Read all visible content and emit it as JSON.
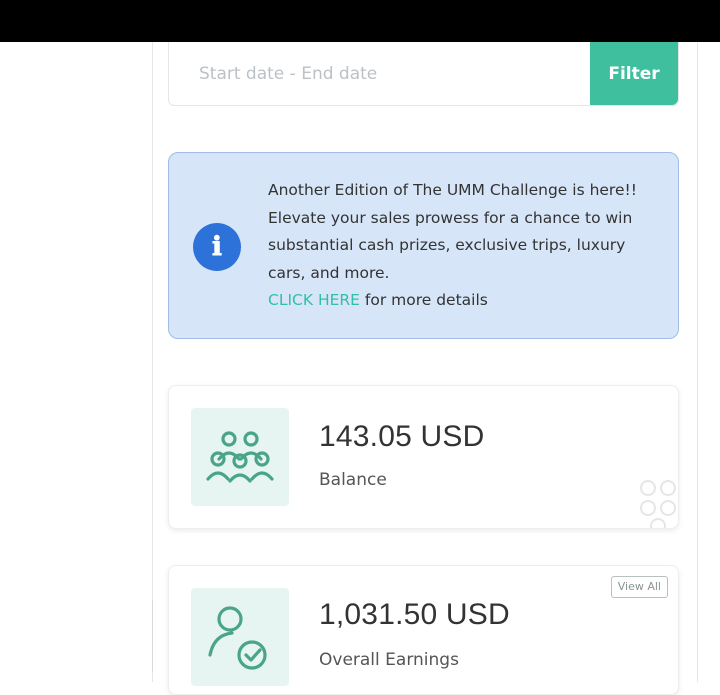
{
  "filter": {
    "date_range_placeholder": "Start date - End date",
    "button_label": "Filter"
  },
  "alert": {
    "icon": "info-icon",
    "message": "Another Edition of The UMM Challenge is here!! Elevate your sales prowess for a chance to win substantial cash prizes, exclusive trips, luxury cars, and more.",
    "link_text": "CLICK HERE",
    "link_suffix": " for more details"
  },
  "cards": {
    "balance": {
      "icon": "users-group-icon",
      "amount": "143.05 USD",
      "label": "Balance"
    },
    "earnings": {
      "icon": "user-check-icon",
      "amount": "1,031.50 USD",
      "label": "Overall Earnings",
      "view_all_label": "View All"
    }
  },
  "colors": {
    "accent": "#3fbf9d",
    "alert_bg": "#d6e5f8",
    "alert_border": "#9fbde6",
    "info_icon": "#2d72d9",
    "link": "#31bfa8",
    "icon_tile_bg": "#e6f5f1",
    "icon_stroke": "#4aa586"
  }
}
